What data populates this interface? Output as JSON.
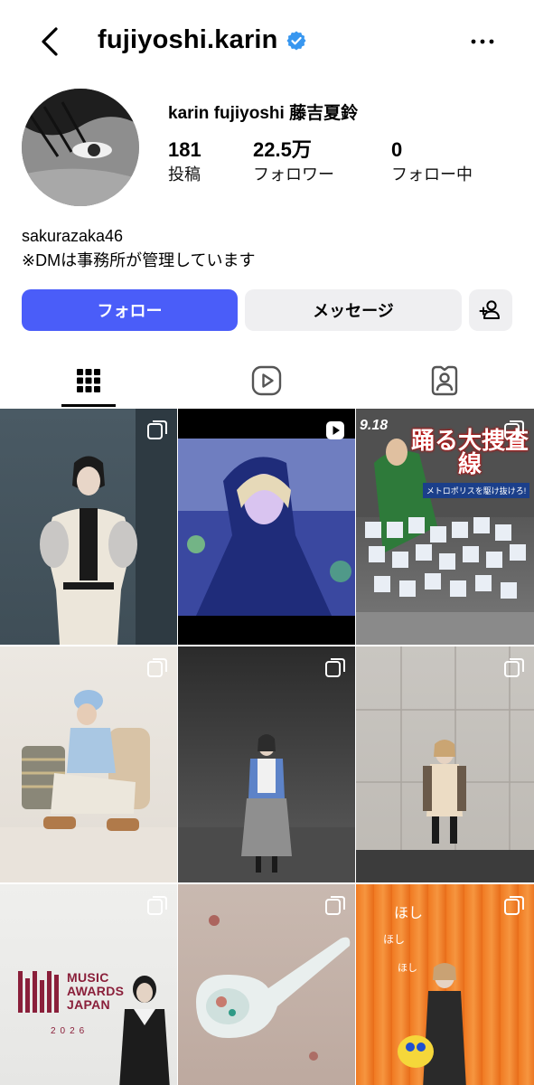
{
  "header": {
    "username": "fujiyoshi.karin"
  },
  "profile": {
    "display_name": "karin fujiyoshi  藤吉夏鈴",
    "stats": [
      {
        "value": "181",
        "label": "投稿"
      },
      {
        "value": "22.5万",
        "label": "フォロワー"
      },
      {
        "value": "0",
        "label": "フォロー中"
      }
    ],
    "bio_lines": [
      "sakurazaka46",
      "※DMは事務所が管理しています"
    ]
  },
  "actions": {
    "follow_label": "フォロー",
    "message_label": "メッセージ"
  },
  "tabs": [
    {
      "icon": "grid-icon",
      "selected": true
    },
    {
      "icon": "reels-icon",
      "selected": false
    },
    {
      "icon": "tagged-icon",
      "selected": false
    }
  ],
  "posts": [
    {
      "type": "carousel"
    },
    {
      "type": "reel"
    },
    {
      "type": "carousel",
      "poster": {
        "date": "9.18",
        "title": "踊る大捜査線",
        "subtitle": "メトロポリスを駆け抜けろ!"
      }
    },
    {
      "type": "carousel"
    },
    {
      "type": "carousel"
    },
    {
      "type": "carousel"
    },
    {
      "type": "carousel",
      "poster": {
        "title_lines": [
          "MUSIC",
          "AWARDS",
          "JAPAN"
        ],
        "year": "2026"
      }
    },
    {
      "type": "carousel"
    },
    {
      "type": "carousel",
      "overlay_text": [
        "ほし",
        "ほし",
        "ほし"
      ]
    }
  ],
  "colors": {
    "follow_button": "#4a5df9",
    "secondary_button": "#efeff1",
    "verified_badge": "#3897f0"
  }
}
